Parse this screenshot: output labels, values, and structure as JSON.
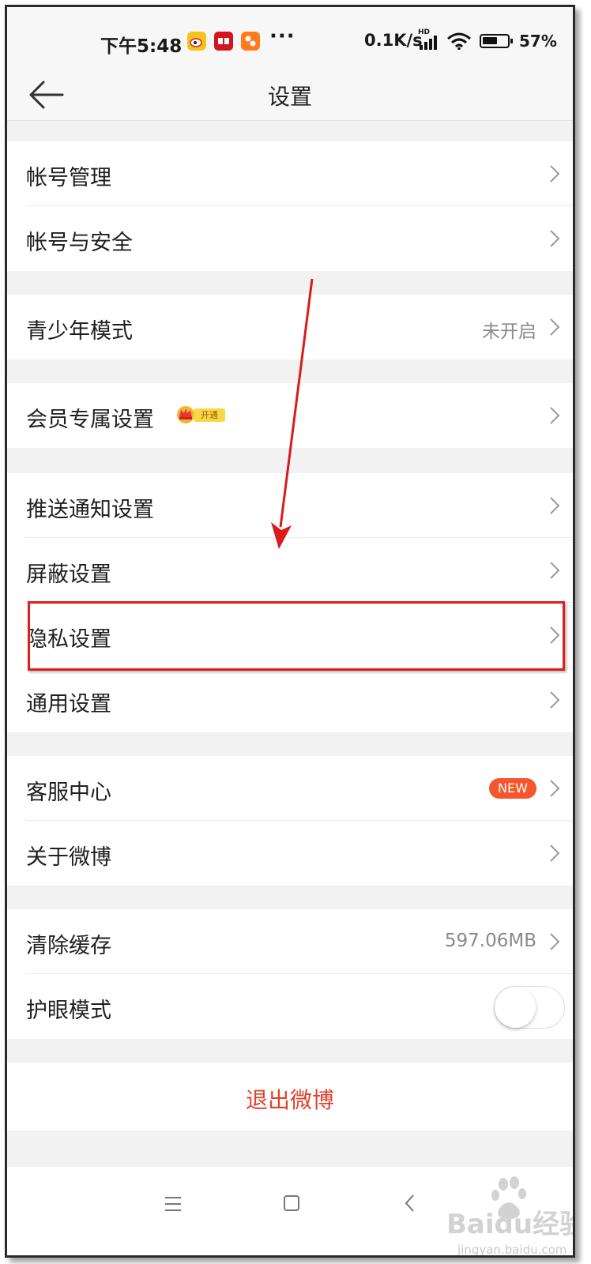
{
  "status_bar": {
    "time": "下午5:48",
    "more": "···",
    "network_speed": "0.1K/s",
    "network_type": "HD",
    "battery_percent": "57%",
    "app_icons": [
      "weibo-icon",
      "youpin-icon",
      "app-icon"
    ]
  },
  "header": {
    "title": "设置",
    "back_icon": "arrow-left-icon"
  },
  "settings": {
    "account_management": "帐号管理",
    "account_security": "帐号与安全",
    "youth_mode": {
      "label": "青少年模式",
      "value": "未开启"
    },
    "vip_settings": {
      "label": "会员专属设置",
      "badge": "开通"
    },
    "push_settings": "推送通知设置",
    "block_settings": "屏蔽设置",
    "privacy_settings": "隐私设置",
    "general_settings": "通用设置",
    "customer_service": {
      "label": "客服中心",
      "badge": "NEW"
    },
    "about": "关于微博",
    "clear_cache": {
      "label": "清除缓存",
      "value": "597.06MB"
    },
    "eye_care": {
      "label": "护眼模式",
      "enabled": false
    },
    "logout": "退出微博"
  },
  "watermark": {
    "brand": "Baidu经验",
    "url": "jingyan.baidu.com"
  },
  "colors": {
    "accent": "#e0442b",
    "new_badge": "#f6562d",
    "annotation": "#e21b1b",
    "background": "#f2f2f2"
  }
}
